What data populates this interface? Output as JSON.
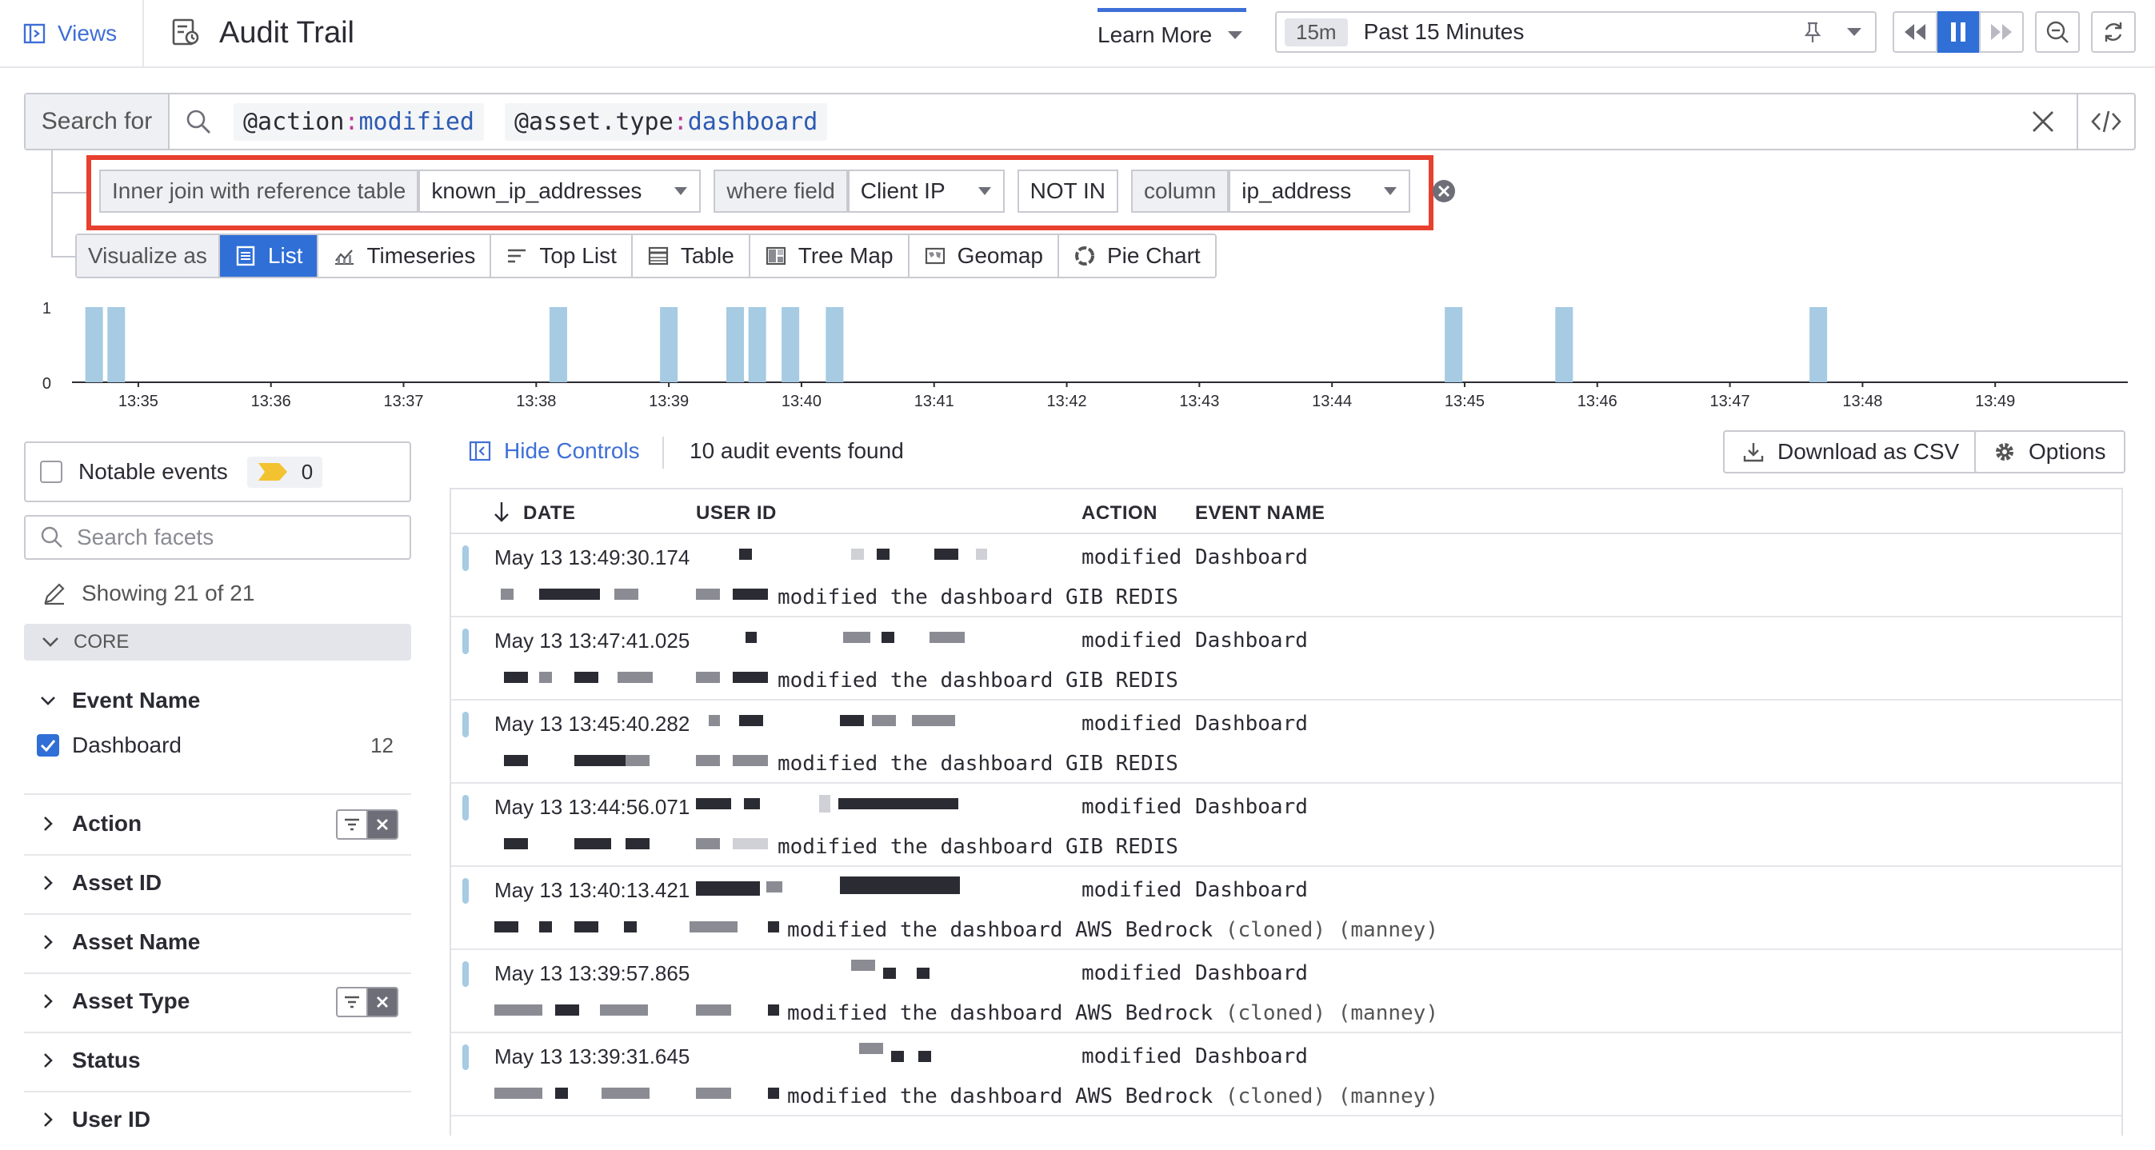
{
  "topbar": {
    "views_label": "Views",
    "title": "Audit Trail",
    "learn_more": "Learn More",
    "time_badge": "15m",
    "time_label": "Past 15 Minutes"
  },
  "search": {
    "prefix": "Search for",
    "chips": [
      {
        "key": "@action",
        "value": "modified"
      },
      {
        "key": "@asset.type",
        "value": "dashboard"
      }
    ]
  },
  "join": {
    "label": "Inner join with reference table",
    "table": "known_ip_addresses",
    "where_label": "where field",
    "field": "Client IP",
    "operator": "NOT IN",
    "column_label": "column",
    "column": "ip_address"
  },
  "visualize": {
    "label": "Visualize as",
    "items": [
      "List",
      "Timeseries",
      "Top List",
      "Table",
      "Tree Map",
      "Geomap",
      "Pie Chart"
    ],
    "active": "List"
  },
  "chart_data": {
    "type": "bar",
    "y_ticks": [
      "1",
      "0"
    ],
    "ylim": [
      0,
      1
    ],
    "x_ticks": [
      "13:35",
      "13:36",
      "13:37",
      "13:38",
      "13:39",
      "13:40",
      "13:41",
      "13:42",
      "13:43",
      "13:44",
      "13:45",
      "13:46",
      "13:47",
      "13:48",
      "13:49"
    ],
    "x_range": [
      "13:34:30",
      "13:50:00"
    ],
    "bars": [
      {
        "t": "13:34:40",
        "v": 1
      },
      {
        "t": "13:34:50",
        "v": 1
      },
      {
        "t": "13:38:10",
        "v": 1
      },
      {
        "t": "13:39:00",
        "v": 1
      },
      {
        "t": "13:39:30",
        "v": 1
      },
      {
        "t": "13:39:40",
        "v": 1
      },
      {
        "t": "13:39:55",
        "v": 1
      },
      {
        "t": "13:40:15",
        "v": 1
      },
      {
        "t": "13:44:55",
        "v": 1
      },
      {
        "t": "13:45:45",
        "v": 1
      },
      {
        "t": "13:47:40",
        "v": 1
      }
    ],
    "color": "#a6cbe3"
  },
  "facets": {
    "notable_label": "Notable events",
    "notable_count": "0",
    "search_placeholder": "Search facets",
    "showing": "Showing 21 of 21",
    "core_label": "CORE",
    "event_name": {
      "label": "Event Name",
      "value": "Dashboard",
      "count": "12"
    },
    "groups": [
      "Action",
      "Asset ID",
      "Asset Name",
      "Asset Type",
      "Status",
      "User ID"
    ]
  },
  "results": {
    "hide_controls": "Hide Controls",
    "found": "10 audit events found",
    "download": "Download as CSV",
    "options": "Options",
    "columns": [
      "DATE",
      "USER ID",
      "ACTION",
      "EVENT NAME"
    ],
    "rows": [
      {
        "date": "May 13 13:49:30.174",
        "action": "modified",
        "event": "Dashboard",
        "desc": "modified the dashboard GIB REDIS",
        "extra": ""
      },
      {
        "date": "May 13 13:47:41.025",
        "action": "modified",
        "event": "Dashboard",
        "desc": "modified the dashboard GIB REDIS",
        "extra": ""
      },
      {
        "date": "May 13 13:45:40.282",
        "action": "modified",
        "event": "Dashboard",
        "desc": "modified the dashboard GIB REDIS",
        "extra": ""
      },
      {
        "date": "May 13 13:44:56.071",
        "action": "modified",
        "event": "Dashboard",
        "desc": "modified the dashboard GIB REDIS",
        "extra": ""
      },
      {
        "date": "May 13 13:40:13.421",
        "action": "modified",
        "event": "Dashboard",
        "desc": "modified the dashboard AWS Bedrock",
        "extra": "(cloned) (manney)"
      },
      {
        "date": "May 13 13:39:57.865",
        "action": "modified",
        "event": "Dashboard",
        "desc": "modified the dashboard AWS Bedrock",
        "extra": "(cloned) (manney)"
      },
      {
        "date": "May 13 13:39:31.645",
        "action": "modified",
        "event": "Dashboard",
        "desc": "modified the dashboard AWS Bedrock",
        "extra": "(cloned) (manney)"
      }
    ]
  }
}
